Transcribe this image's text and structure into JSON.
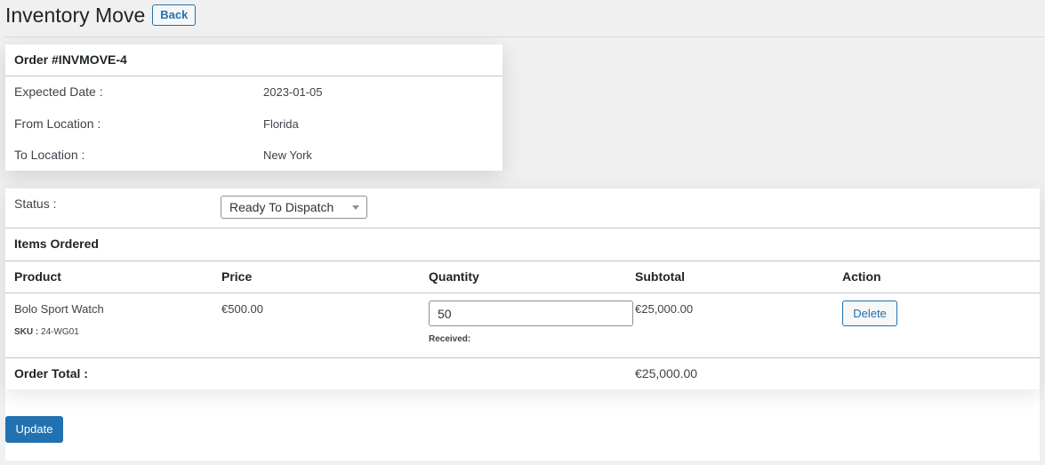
{
  "header": {
    "title": "Inventory Move",
    "back_label": "Back"
  },
  "order": {
    "title": "Order #INVMOVE-4",
    "rows": [
      {
        "label": "Expected Date :",
        "value": "2023-01-05"
      },
      {
        "label": "From Location :",
        "value": "Florida"
      },
      {
        "label": "To Location :",
        "value": "New York"
      }
    ]
  },
  "status": {
    "label": "Status :",
    "selected": "Ready To Dispatch"
  },
  "items": {
    "heading": "Items Ordered",
    "columns": [
      "Product",
      "Price",
      "Quantity",
      "Subtotal",
      "Action"
    ],
    "rows": [
      {
        "product": "Bolo Sport Watch",
        "sku_label": "SKU :",
        "sku": "24-WG01",
        "price": "€500.00",
        "quantity": "50",
        "received_label": "Received:",
        "subtotal": "€25,000.00",
        "action": "Delete"
      }
    ],
    "total_label": "Order Total :",
    "total_value": "€25,000.00"
  },
  "actions": {
    "update_label": "Update"
  }
}
